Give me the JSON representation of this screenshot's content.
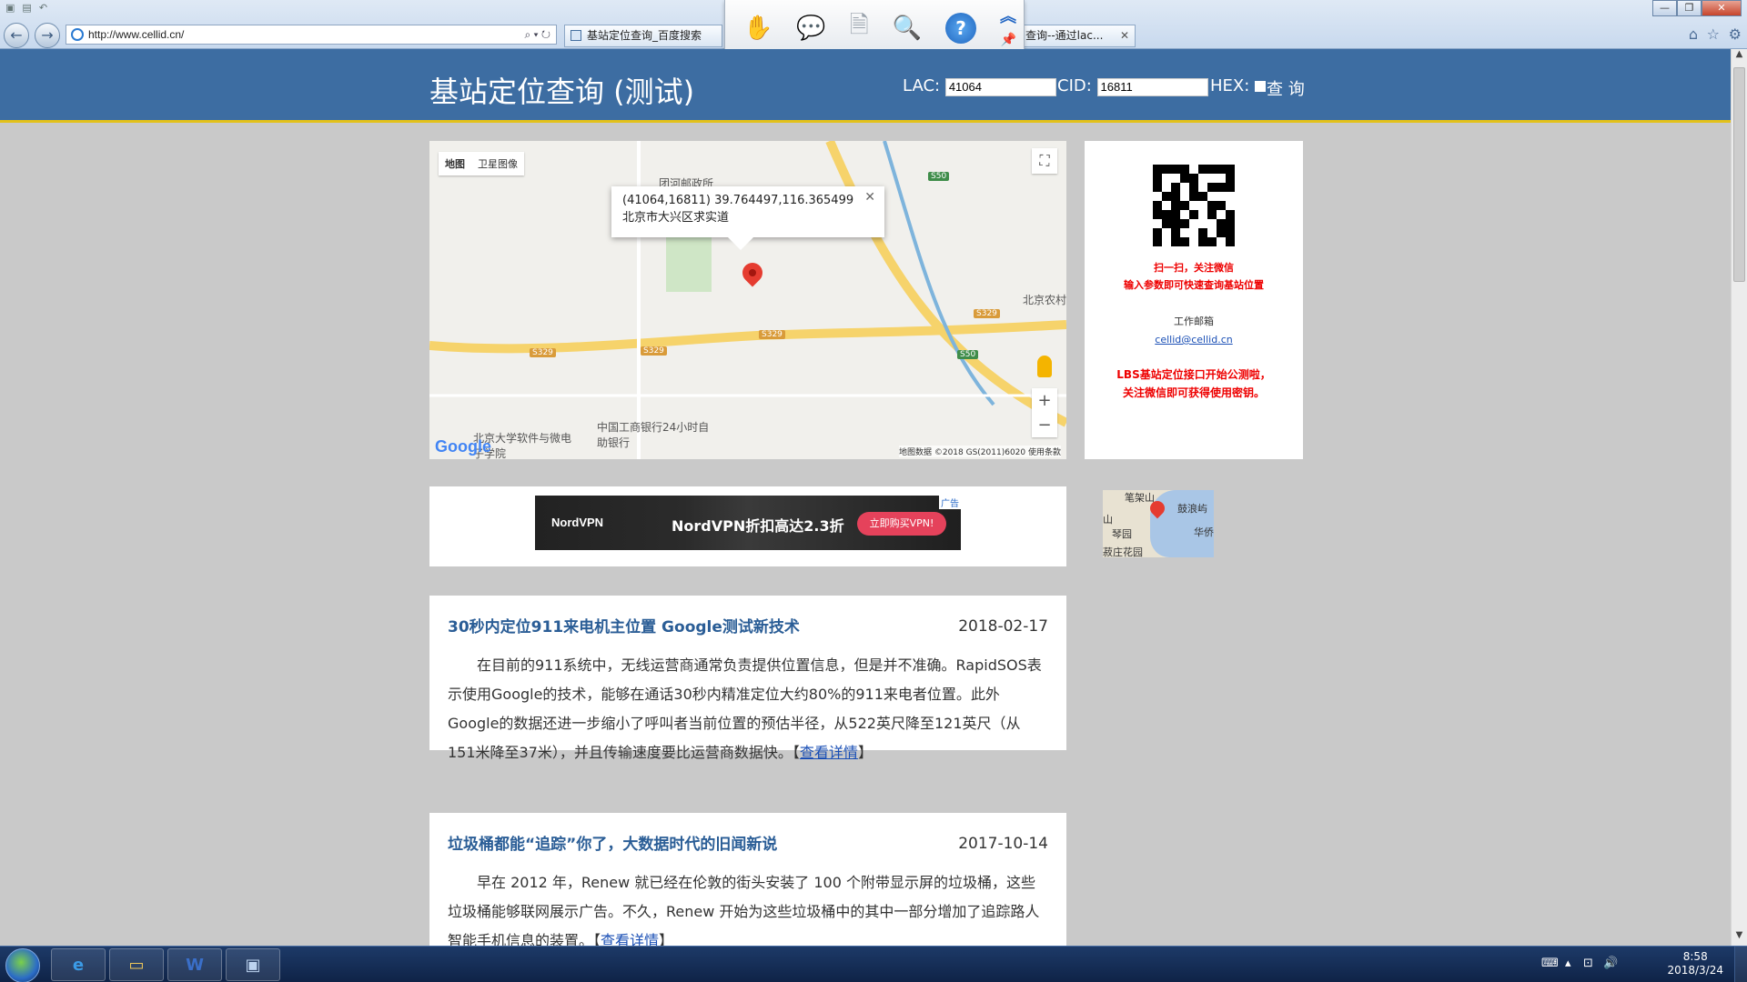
{
  "browser": {
    "url": "http://www.cellid.cn/",
    "tabs": [
      {
        "label": "基站定位查询_百度搜索"
      },
      {
        "label": "查询--通过lac..."
      }
    ]
  },
  "header": {
    "title": "基站定位查询 (测试)",
    "lac_label": "LAC:",
    "lac_value": "41064",
    "cid_label": "CID:",
    "cid_value": "16811",
    "hex_label": "HEX:",
    "query_button": "查 询"
  },
  "map": {
    "type_map": "地图",
    "type_satellite": "卫星图像",
    "infowindow_line1": "(41064,16811) 39.764497,116.365499",
    "infowindow_line2": "北京市大兴区求实道",
    "labels": [
      "团河邮政所",
      "北京农村",
      "中国工商银行24小时自助银行",
      "北京大学软件与微电子学院"
    ],
    "shields": [
      "S50",
      "S329",
      "S329",
      "S329",
      "S329",
      "S50"
    ],
    "watermark": "Google",
    "footer": "地图数据 ©2018 GS(2011)6020   使用条款"
  },
  "sidebar": {
    "scan_line1": "扫一扫，关注微信",
    "scan_line2": "输入参数即可快速查询基站位置",
    "email_label": "工作邮箱",
    "email": "cellid@cellid.cn",
    "lbs_line1": "LBS基站定位接口开始公测啦，",
    "lbs_line2": "关注微信即可获得使用密钥。"
  },
  "thumb_map": {
    "labels": [
      "笔架山",
      "鼓浪屿",
      "华侨",
      "山",
      "琴园",
      "菽庄花园"
    ]
  },
  "ad": {
    "tag": "广告",
    "logo": "NordVPN",
    "text": "NordVPN折扣高达2.3折",
    "button": "立即购买VPN!"
  },
  "news": [
    {
      "title": "30秒内定位911来电机主位置 Google测试新技术",
      "date": "2018-02-17",
      "body": "在目前的911系统中，无线运营商通常负责提供位置信息，但是并不准确。RapidSOS表示使用Google的技术，能够在通话30秒内精准定位大约80%的911来电者位置。此外Google的数据还进一步缩小了呼叫者当前位置的预估半径，从522英尺降至121英尺（从151米降至37米），并且传输速度要比运营商数据快。",
      "link": "查看详情"
    },
    {
      "title": "垃圾桶都能“追踪”你了，大数据时代的旧闻新说",
      "date": "2017-10-14",
      "body": "早在 2012 年，Renew 就已经在伦敦的街头安装了 100 个附带显示屏的垃圾桶，这些垃圾桶能够联网展示广告。不久，Renew 开始为这些垃圾桶中的其中一部分增加了追踪路人智能手机信息的装置。",
      "link": "查看详情"
    }
  ],
  "taskbar": {
    "time": "8:58",
    "date": "2018/3/24"
  },
  "colors": {
    "header_bg": "#3d6da2",
    "header_border": "#e3c11a",
    "page_bg": "#c9c9c9",
    "link": "#2a5d96",
    "alert_red": "#e00000"
  }
}
